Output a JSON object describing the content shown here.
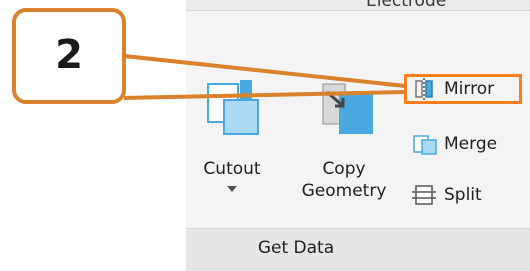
{
  "ribbon": {
    "top_label": "Electrode",
    "group_label": "Get Data",
    "cutout": {
      "line1": "Cutout"
    },
    "copy_geometry": {
      "line1": "Copy",
      "line2": "Geometry"
    },
    "mirror": {
      "label": "Mirror"
    },
    "merge": {
      "label": "Merge"
    },
    "split": {
      "label": "Split"
    }
  },
  "callout": {
    "number": "2"
  },
  "colors": {
    "highlight": "#ff7f1e",
    "callout_border": "#d9822b",
    "icon_blue": "#49a8e0"
  }
}
